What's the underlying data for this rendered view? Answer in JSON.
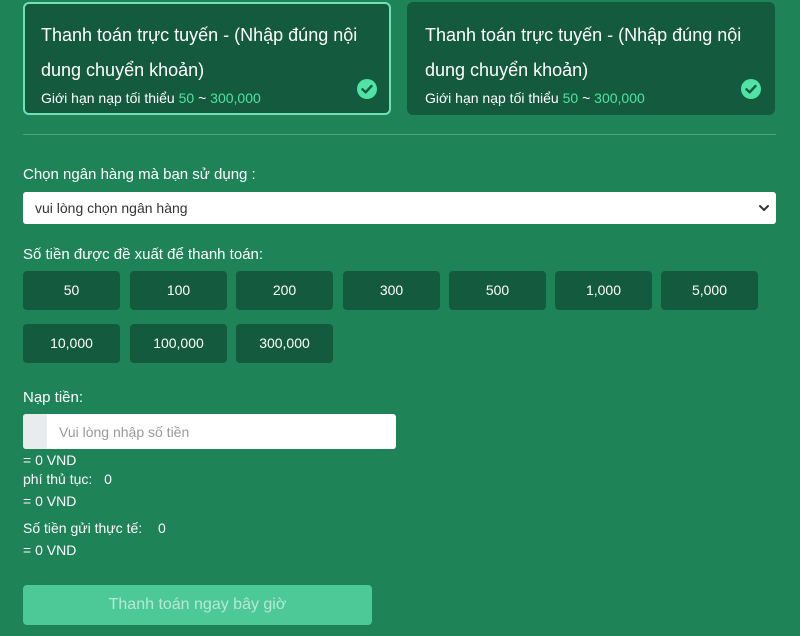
{
  "payment_methods": [
    {
      "title": "Thanh toán trực tuyến - (Nhập đúng nội dung chuyển khoản)",
      "limit_prefix": "Giới hạn nạp tối thiểu",
      "limit_min": "50",
      "limit_sep": "~",
      "limit_max": "300,000",
      "selected": true
    },
    {
      "title": "Thanh toán trực tuyến - (Nhập đúng nội dung chuyển khoản)",
      "limit_prefix": "Giới hạn nạp tối thiểu",
      "limit_min": "50",
      "limit_sep": "~",
      "limit_max": "300,000",
      "selected": false
    }
  ],
  "bank": {
    "label": "Chọn ngân hàng mà bạn sử dụng :",
    "selected": "vui lòng chọn ngân hàng"
  },
  "suggested": {
    "label": "Số tiền được đề xuất để thanh toán:",
    "amounts": [
      "50",
      "100",
      "200",
      "300",
      "500",
      "1,000",
      "5,000",
      "10,000",
      "100,000",
      "300,000"
    ]
  },
  "deposit": {
    "label": "Nạp tiền:",
    "placeholder": "Vui lòng nhập số tiền",
    "value": "",
    "converted": "= 0 VND"
  },
  "fee": {
    "label": "phí thủ tục:",
    "value": "0",
    "converted": "= 0 VND"
  },
  "actual": {
    "label": "Số tiền gửi thực tế:",
    "value": "0",
    "converted": "= 0 VND"
  },
  "submit_label": "Thanh toán ngay bây giờ",
  "colors": {
    "background": "#1e8457",
    "card": "#145a3f",
    "accent": "#4fe3a5",
    "submit": "#4dc998"
  }
}
